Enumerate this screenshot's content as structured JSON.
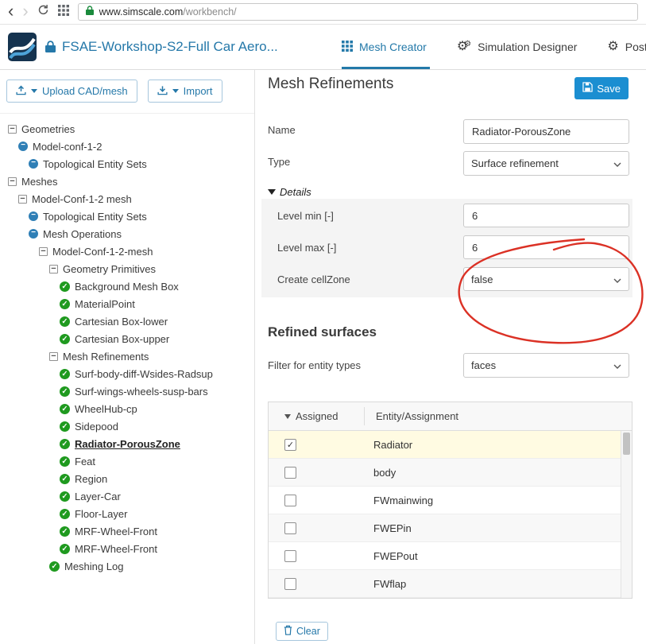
{
  "browser": {
    "url_host": "www.simscale.com",
    "url_path": "/workbench/"
  },
  "header": {
    "project_title": "FSAE-Workshop-S2-Full Car Aero...",
    "tabs": [
      {
        "label": "Mesh Creator"
      },
      {
        "label": "Simulation Designer"
      },
      {
        "label": "Post-"
      }
    ]
  },
  "sidebar": {
    "upload_button": "Upload CAD/mesh",
    "import_button": "Import",
    "tree": [
      {
        "label": "Geometries",
        "level": 0,
        "icon": "collapse"
      },
      {
        "label": "Model-conf-1-2",
        "level": 1,
        "icon": "blue"
      },
      {
        "label": "Topological Entity Sets",
        "level": 2,
        "icon": "blue"
      },
      {
        "label": "Meshes",
        "level": 0,
        "icon": "collapse"
      },
      {
        "label": "Model-Conf-1-2 mesh",
        "level": 1,
        "icon": "collapse"
      },
      {
        "label": "Topological Entity Sets",
        "level": 2,
        "icon": "blue"
      },
      {
        "label": "Mesh Operations",
        "level": 2,
        "icon": "blue"
      },
      {
        "label": "Model-Conf-1-2-mesh",
        "level": 3,
        "icon": "collapse"
      },
      {
        "label": "Geometry Primitives",
        "level": 4,
        "icon": "collapse"
      },
      {
        "label": "Background Mesh Box",
        "level": 5,
        "icon": "check"
      },
      {
        "label": "MaterialPoint",
        "level": 5,
        "icon": "check"
      },
      {
        "label": "Cartesian Box-lower",
        "level": 5,
        "icon": "check"
      },
      {
        "label": "Cartesian Box-upper",
        "level": 5,
        "icon": "check"
      },
      {
        "label": "Mesh Refinements",
        "level": 4,
        "icon": "collapse"
      },
      {
        "label": "Surf-body-diff-Wsides-Radsup",
        "level": 5,
        "icon": "check"
      },
      {
        "label": "Surf-wings-wheels-susp-bars",
        "level": 5,
        "icon": "check"
      },
      {
        "label": "WheelHub-cp",
        "level": 5,
        "icon": "check"
      },
      {
        "label": "Sidepood",
        "level": 5,
        "icon": "check"
      },
      {
        "label": "Radiator-PorousZone",
        "level": 5,
        "icon": "check",
        "selected": true
      },
      {
        "label": "Feat",
        "level": 5,
        "icon": "check"
      },
      {
        "label": "Region",
        "level": 5,
        "icon": "check"
      },
      {
        "label": "Layer-Car",
        "level": 5,
        "icon": "check"
      },
      {
        "label": "Floor-Layer",
        "level": 5,
        "icon": "check"
      },
      {
        "label": "MRF-Wheel-Front",
        "level": 5,
        "icon": "check"
      },
      {
        "label": "MRF-Wheel-Front",
        "level": 5,
        "icon": "check"
      },
      {
        "label": "Meshing Log",
        "level": 4,
        "icon": "check"
      }
    ]
  },
  "main": {
    "title": "Mesh Refinements",
    "save_label": "Save",
    "form": {
      "name_label": "Name",
      "name_value": "Radiator-PorousZone",
      "type_label": "Type",
      "type_value": "Surface refinement",
      "details_label": "Details",
      "level_min_label": "Level min [-]",
      "level_min_value": "6",
      "level_max_label": "Level max [-]",
      "level_max_value": "6",
      "cellzone_label": "Create cellZone",
      "cellzone_value": "false"
    },
    "refined": {
      "heading": "Refined surfaces",
      "filter_label": "Filter for entity types",
      "filter_value": "faces",
      "table": {
        "assigned_col": "Assigned",
        "entity_col": "Entity/Assignment",
        "rows": [
          {
            "entity": "Radiator",
            "checked": true
          },
          {
            "entity": "body",
            "checked": false
          },
          {
            "entity": "FWmainwing",
            "checked": false
          },
          {
            "entity": "FWEPin",
            "checked": false
          },
          {
            "entity": "FWEPout",
            "checked": false
          },
          {
            "entity": "FWflap",
            "checked": false
          }
        ]
      },
      "clear_label": "Clear"
    }
  },
  "colors": {
    "accent_blue": "#2379a9",
    "save_blue": "#1b8ed1",
    "check_green": "#1f9a1f",
    "annotation_red": "#db3125",
    "selected_row_bg": "#fffbe2"
  }
}
